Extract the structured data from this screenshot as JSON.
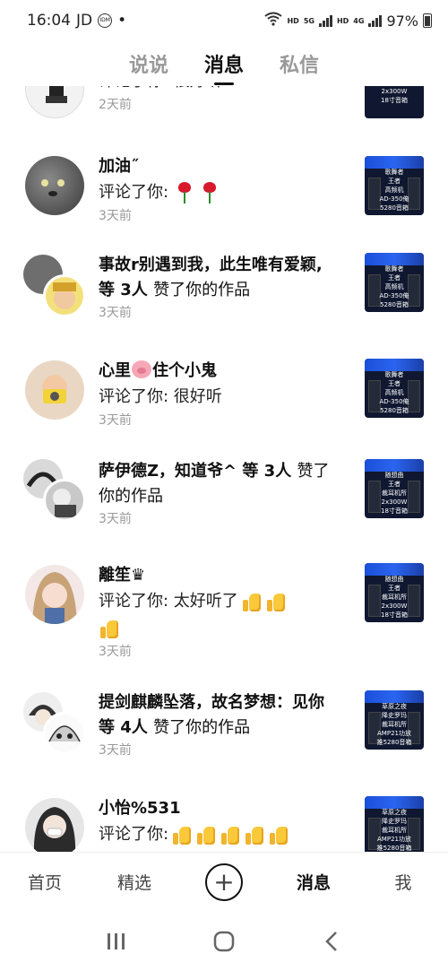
{
  "status_bar": {
    "time": "16:04",
    "carrier": "JD",
    "badge1": "IDM",
    "dot": "•",
    "hd1": "HD",
    "net1": "5G",
    "hd2": "HD",
    "net2": "4G",
    "battery": "97%"
  },
  "tabs": [
    {
      "label": "说说",
      "active": false
    },
    {
      "label": "消息",
      "active": true
    },
    {
      "label": "私信",
      "active": false
    }
  ],
  "notifications": [
    {
      "name": "",
      "action": "",
      "content": "评论了你: 很好听",
      "time": "2天前",
      "thumb": [
        "2x300W",
        "18寸音箱"
      ]
    },
    {
      "name": "加油˝",
      "action": "",
      "content": "评论了你:",
      "emoji": "rose-icon x2",
      "time": "3天前",
      "thumb": [
        "歌舞者",
        "王者",
        "高频机",
        "AD-350俺",
        "5280音箱"
      ]
    },
    {
      "name": "事故r别遇到我，此生唯有爱颖, 等 3人",
      "action": "赞了你的作品",
      "time": "3天前",
      "thumb": [
        "歌舞者",
        "王者",
        "高频机",
        "AD-350俺",
        "5280音箱"
      ]
    },
    {
      "name_part1": "心里",
      "name_part2": "住个小鬼",
      "content": "评论了你: 很好听",
      "time": "3天前",
      "thumb": [
        "歌舞者",
        "王者",
        "高频机",
        "AD-350俺",
        "5280音箱"
      ]
    },
    {
      "name": "萨伊德Z，知道爷^ 等 3人",
      "action": "赞了你的作品",
      "time": "3天前",
      "thumb": [
        "随想曲",
        "王者",
        "裁耳机所",
        "2x300W",
        "18寸音箱"
      ]
    },
    {
      "name": "離笙♛",
      "content": "评论了你: 太好听了",
      "time": "3天前",
      "thumb": [
        "随想曲",
        "王者",
        "裁耳机所",
        "2x300W",
        "18寸音箱"
      ]
    },
    {
      "name": "提剑麒麟坠落，故名梦想：见你 等 4人",
      "action": "赞了你的作品",
      "time": "3天前",
      "thumb": [
        "草原之夜",
        "降史罗玛",
        "裁耳机所",
        "AMP21功放",
        "推5280音箱"
      ]
    },
    {
      "name": "小怡%531",
      "content": "评论了你:",
      "time": "",
      "thumb": [
        "草原之夜",
        "降史罗玛",
        "裁耳机所",
        "AMP21功放",
        "推5280音箱"
      ]
    }
  ],
  "bottom_nav": [
    {
      "label": "首页"
    },
    {
      "label": "精选"
    },
    {
      "label": "+"
    },
    {
      "label": "消息",
      "active": true
    },
    {
      "label": "我"
    }
  ]
}
